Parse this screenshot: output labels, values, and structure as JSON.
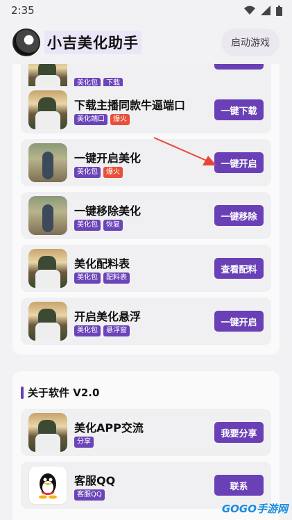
{
  "status": {
    "time": "2:35"
  },
  "header": {
    "title": "小吉美化助手",
    "launch_label": "启动游戏"
  },
  "items": [
    {
      "title": "下载主播同款牛逼端口",
      "tags": [
        {
          "label": "美化端口",
          "color": "#6b45b8"
        },
        {
          "label": "爆火",
          "color": "#e8503a"
        }
      ],
      "action": "一键下载",
      "thumb": "pubg-character"
    },
    {
      "title": "一键开启美化",
      "tags": [
        {
          "label": "美化包",
          "color": "#6b45b8"
        },
        {
          "label": "爆火",
          "color": "#e8503a"
        }
      ],
      "action": "一键开启",
      "thumb": "game-skin-photo"
    },
    {
      "title": "一键移除美化",
      "tags": [
        {
          "label": "美化包",
          "color": "#6b45b8"
        },
        {
          "label": "恢复",
          "color": "#6b45b8"
        }
      ],
      "action": "一键移除",
      "thumb": "game-skin-photo"
    },
    {
      "title": "美化配料表",
      "tags": [
        {
          "label": "美化包",
          "color": "#6b45b8"
        },
        {
          "label": "配料表",
          "color": "#6b45b8"
        }
      ],
      "action": "查看配料",
      "thumb": "pubg-character"
    },
    {
      "title": "开启美化悬浮",
      "tags": [
        {
          "label": "美化包",
          "color": "#6b45b8"
        },
        {
          "label": "悬浮窗",
          "color": "#6b45b8"
        }
      ],
      "action": "一键开启",
      "thumb": "pubg-character"
    }
  ],
  "partial_top": {
    "tags": [
      {
        "label": "美化包",
        "color": "#6b45b8"
      },
      {
        "label": "下载",
        "color": "#6b45b8"
      }
    ]
  },
  "about": {
    "title": "关于软件 V2.0",
    "items": [
      {
        "title": "美化APP交流",
        "tags": [
          {
            "label": "分享",
            "color": "#6b45b8"
          }
        ],
        "action": "我要分享",
        "thumb": "pubg-character"
      },
      {
        "title": "客服QQ",
        "tags": [
          {
            "label": "客服QQ",
            "color": "#6b45b8"
          }
        ],
        "action": "联系",
        "thumb": "qq-penguin"
      }
    ]
  },
  "watermark": "GOGO手游网",
  "colors": {
    "accent": "#6a40b6",
    "tag_red": "#e8503a",
    "arrow": "#e8443a"
  }
}
